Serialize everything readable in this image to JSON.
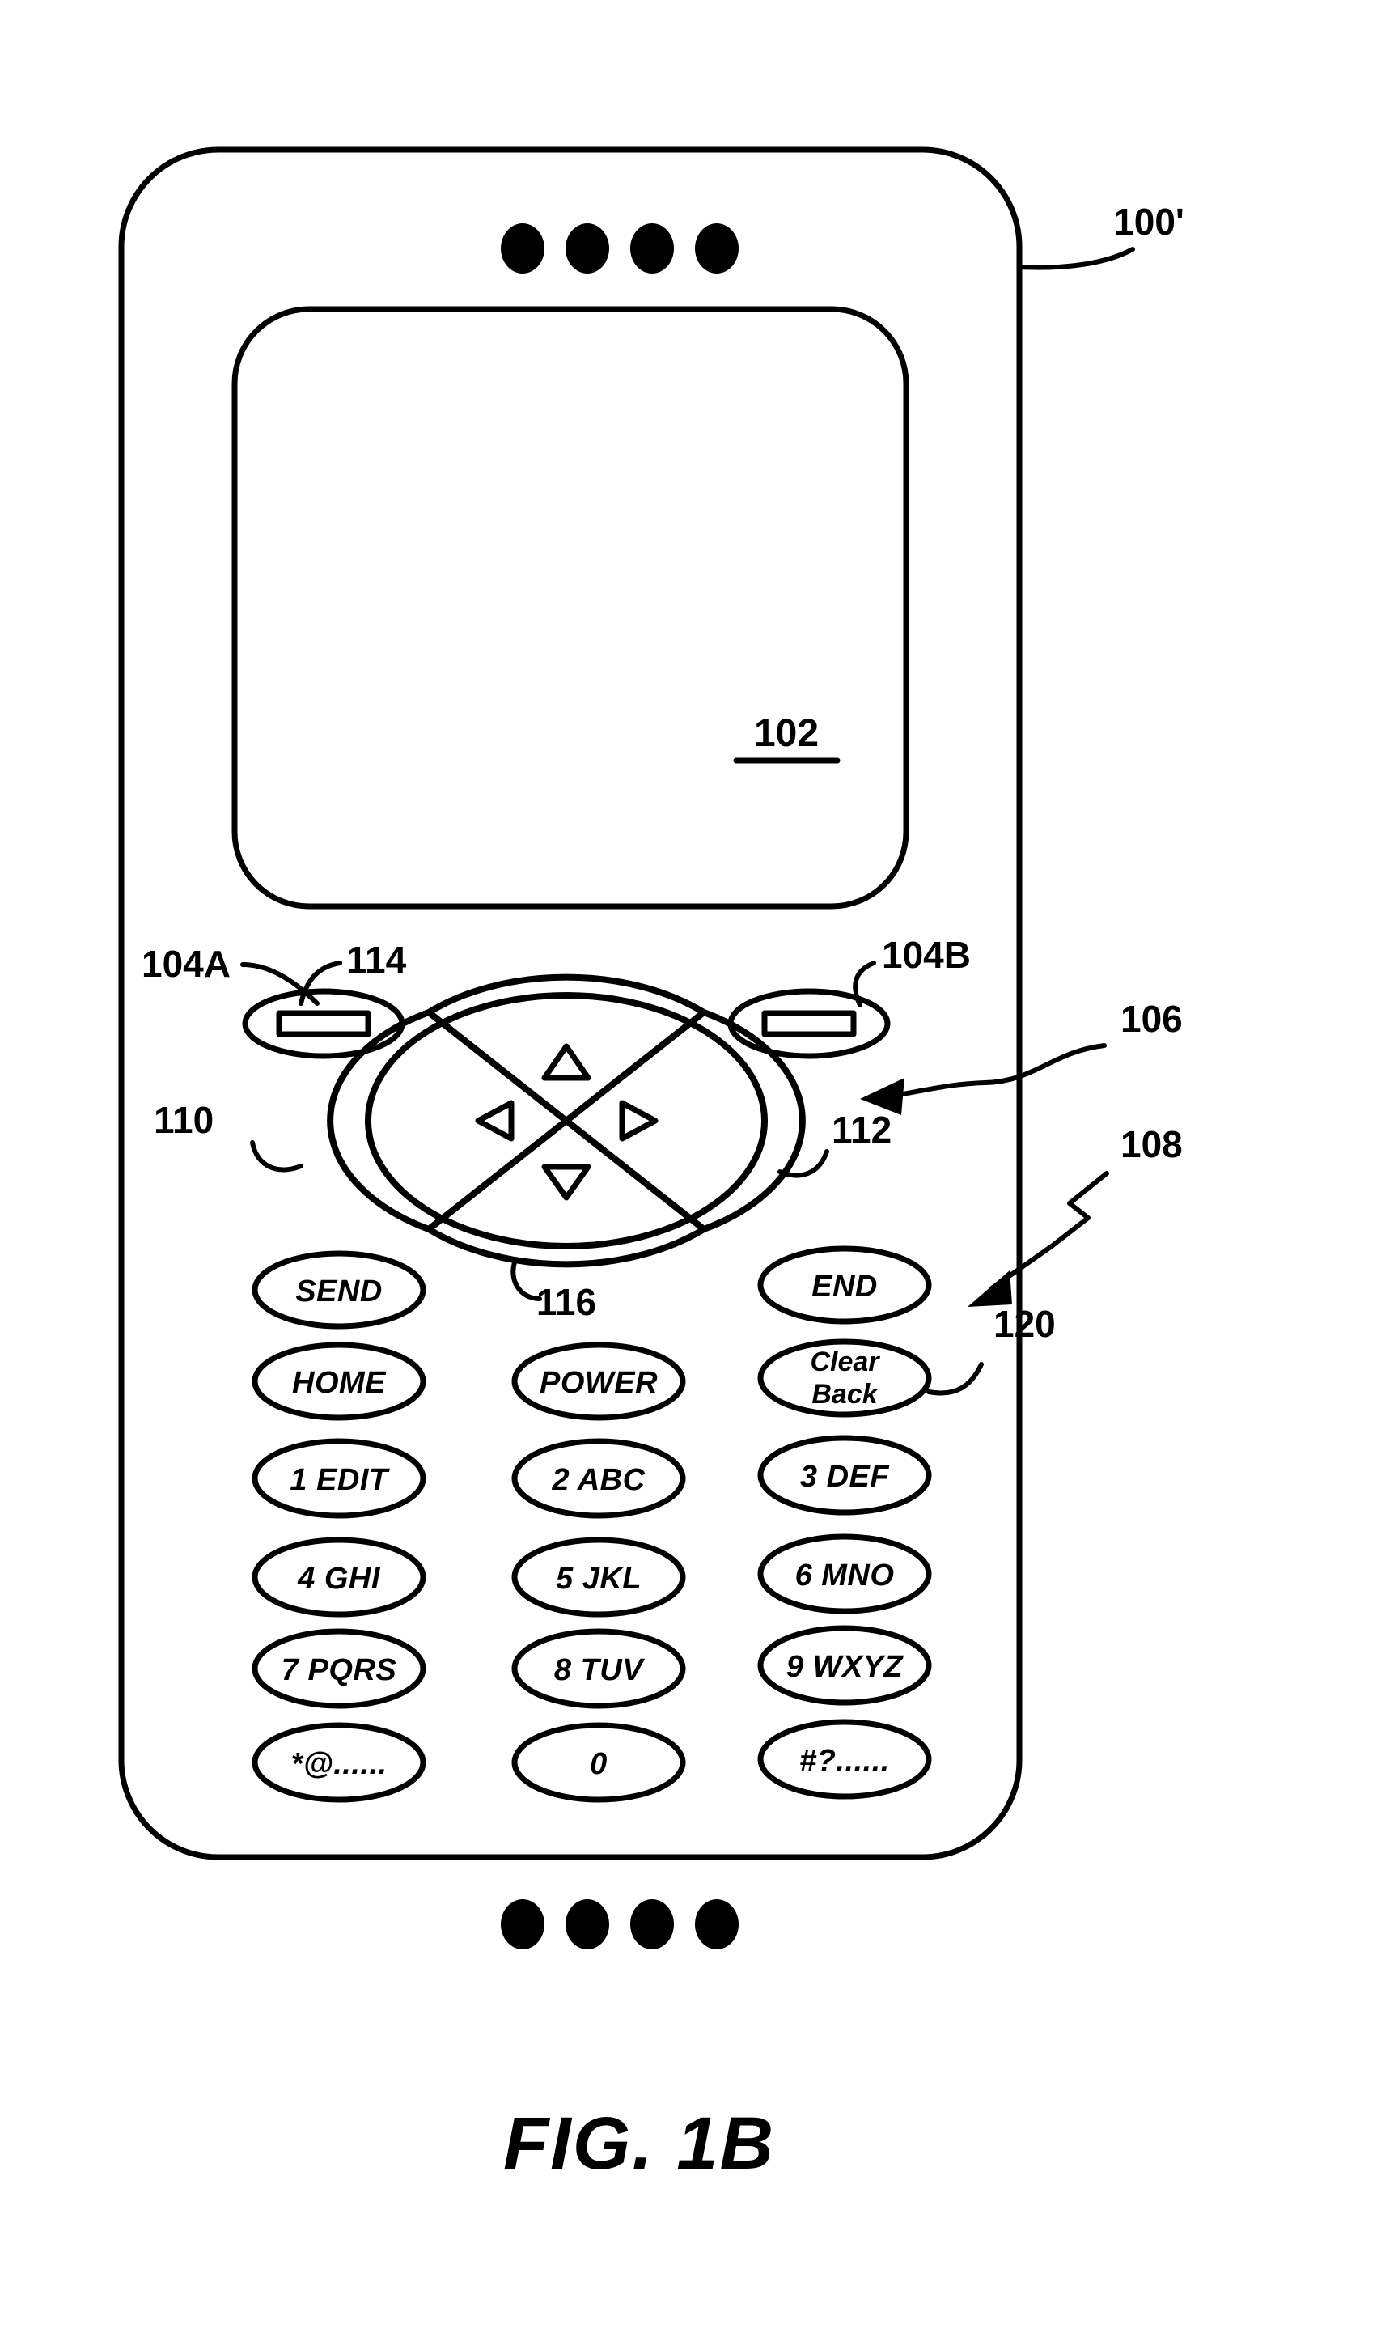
{
  "figure": {
    "caption": "FIG. 1B",
    "device_ref": "100'",
    "display_ref": "102"
  },
  "reference_numerals": {
    "device": "100'",
    "display": "102",
    "softkey_left": "104A",
    "softkey_right": "104B",
    "navigation_pad": "106",
    "keypad": "108",
    "left_segment": "110",
    "right_segment": "112",
    "up_segment": "114",
    "down_segment": "116",
    "clear_back_key": "120"
  },
  "navigation_pad": {
    "ref": "106",
    "segments": [
      {
        "ref": "114",
        "direction": "up",
        "icon": "triangle-up-icon"
      },
      {
        "ref": "110",
        "direction": "left",
        "icon": "triangle-left-icon"
      },
      {
        "ref": "112",
        "direction": "right",
        "icon": "triangle-right-icon"
      },
      {
        "ref": "116",
        "direction": "down",
        "icon": "triangle-down-icon"
      }
    ]
  },
  "softkeys": [
    {
      "ref": "104A",
      "position": "left",
      "icon": "soft-key-bar-icon"
    },
    {
      "ref": "104B",
      "position": "right",
      "icon": "soft-key-bar-icon"
    }
  ],
  "speaker_dots": {
    "top_count": 4,
    "bottom_count": 4
  },
  "keypad": {
    "ref": "108",
    "rows": [
      [
        {
          "label": "SEND",
          "name": "send"
        },
        {
          "label": "",
          "name": "empty"
        },
        {
          "label": "END",
          "name": "end"
        }
      ],
      [
        {
          "label": "HOME",
          "name": "home"
        },
        {
          "label": "POWER",
          "name": "power"
        },
        {
          "label": "Clear\nBack",
          "name": "clear-back"
        }
      ],
      [
        {
          "label": "1 EDIT",
          "name": "key-1"
        },
        {
          "label": "2 ABC",
          "name": "key-2"
        },
        {
          "label": "3 DEF",
          "name": "key-3"
        }
      ],
      [
        {
          "label": "4 GHI",
          "name": "key-4"
        },
        {
          "label": "5 JKL",
          "name": "key-5"
        },
        {
          "label": "6 MNO",
          "name": "key-6"
        }
      ],
      [
        {
          "label": "7 PQRS",
          "name": "key-7"
        },
        {
          "label": "8 TUV",
          "name": "key-8"
        },
        {
          "label": "9 WXYZ",
          "name": "key-9"
        }
      ],
      [
        {
          "label": "*@......",
          "name": "key-star"
        },
        {
          "label": "0",
          "name": "key-0"
        },
        {
          "label": "#?......",
          "name": "key-pound"
        }
      ]
    ],
    "labels": {
      "send": "SEND",
      "end": "END",
      "home": "HOME",
      "power": "POWER",
      "clear": "Clear",
      "back": "Back",
      "key1": "1 EDIT",
      "key2": "2 ABC",
      "key3": "3 DEF",
      "key4": "4 GHI",
      "key5": "5 JKL",
      "key6": "6 MNO",
      "key7": "7 PQRS",
      "key8": "8 TUV",
      "key9": "9 WXYZ",
      "keystar": "*@......",
      "key0": "0",
      "keypound": "#?......"
    }
  },
  "colors": {
    "ink": "#000000",
    "paper": "#ffffff"
  }
}
